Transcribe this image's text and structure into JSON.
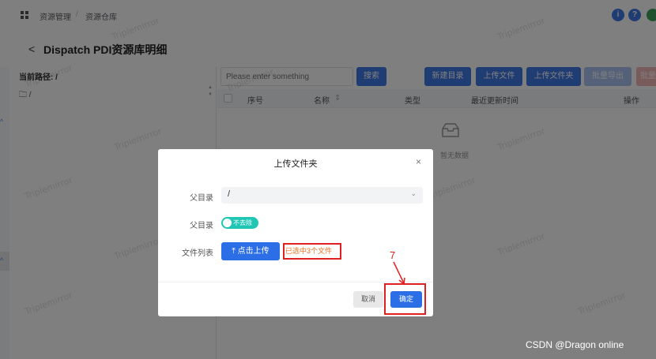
{
  "header": {
    "breadcrumb": [
      "资源管理",
      "资源仓库"
    ],
    "separator": "/",
    "info_icon_label": "i",
    "help_icon_label": "?"
  },
  "page": {
    "back_symbol": "<",
    "title": "Dispatch PDI资源库明细"
  },
  "left_panel": {
    "path_label": "当前路径:",
    "path_value": "/",
    "tree_root": "/"
  },
  "toolbar": {
    "search_placeholder": "Please enter something",
    "search_button": "搜索",
    "new_folder": "新建目录",
    "upload_file": "上传文件",
    "upload_folder": "上传文件夹",
    "batch_export": "批量导出",
    "batch_delete": "批量"
  },
  "table": {
    "columns": [
      "序号",
      "名称",
      "类型",
      "最近更新时间",
      "操作"
    ],
    "sort_symbol": "⇕",
    "empty_text": "暂无数据"
  },
  "dialog": {
    "title": "上传文件夹",
    "close_symbol": "×",
    "parent_dir_label": "父目录",
    "parent_dir_value": "/",
    "dedupe_label": "父目录",
    "dedupe_switch_text": "不去除",
    "dedupe_switch_on": true,
    "file_list_label": "文件列表",
    "upload_button": "点击上传",
    "upload_icon_symbol": "⤒",
    "selected_text": "已选中3个文件",
    "cancel_button": "取消",
    "confirm_button": "确定"
  },
  "annotation": {
    "step_number": "7"
  },
  "watermark_text": "Triplemirror",
  "footer_credit": "CSDN @Dragon online",
  "colors": {
    "primary": "#2b6ee6",
    "switch": "#1fc6b4",
    "highlight": "#e02020",
    "selected_text": "#f07020"
  }
}
